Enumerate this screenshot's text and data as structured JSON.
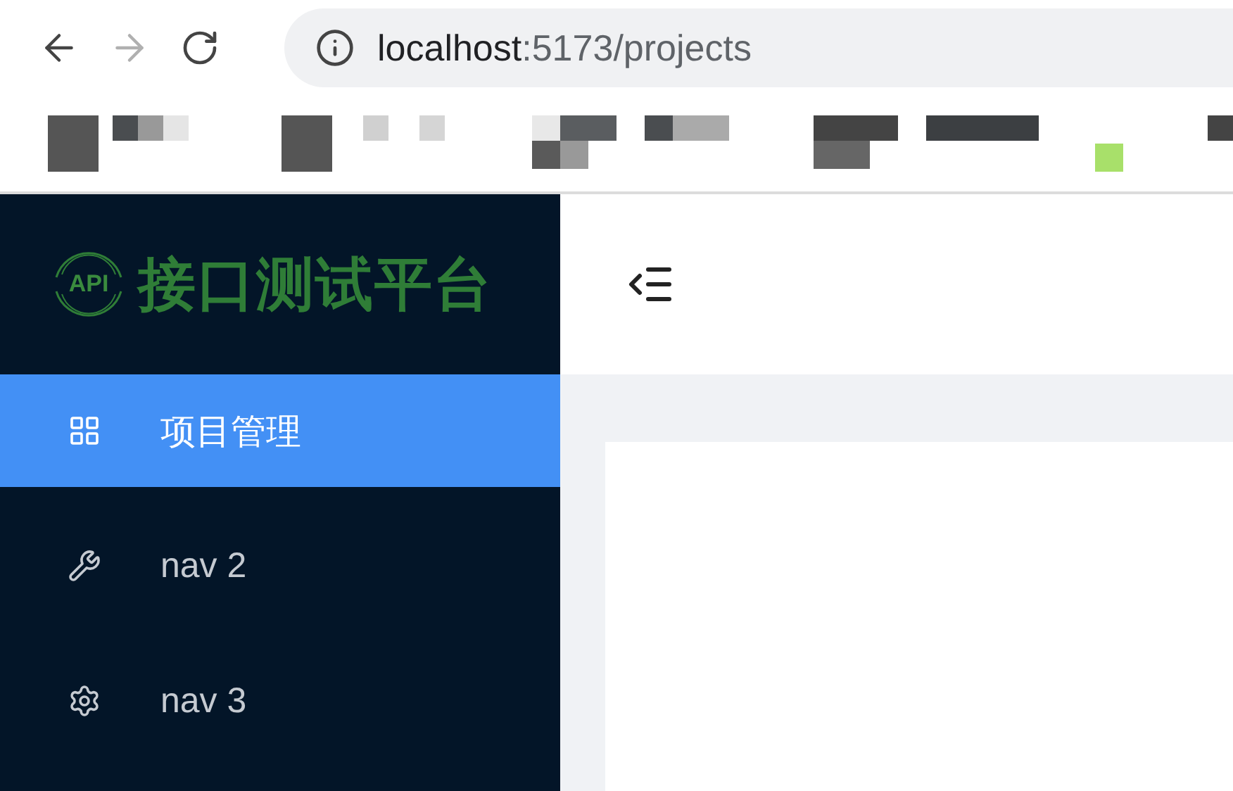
{
  "browser": {
    "url_host": "localhost",
    "url_path": ":5173/projects",
    "forward_disabled": true
  },
  "sidebar": {
    "logo_badge": "API",
    "logo_title": "接口测试平台",
    "items": [
      {
        "label": "项目管理",
        "selected": true
      },
      {
        "label": "nav 2",
        "selected": false
      },
      {
        "label": "nav 3",
        "selected": false
      }
    ]
  },
  "header": {
    "collapse_expanded": true
  }
}
